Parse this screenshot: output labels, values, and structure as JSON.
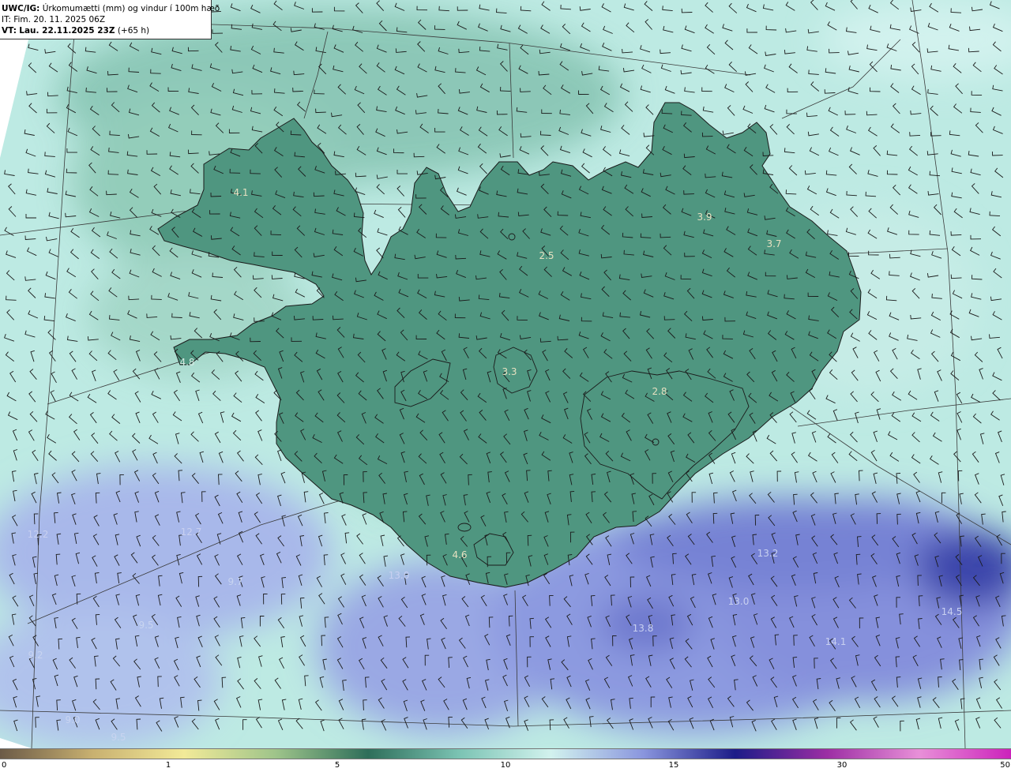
{
  "header": {
    "model": "UWC/IG:",
    "title": "Úrkomumætti (mm) og vindur í 100m hæð",
    "issue_time": "IT: Fim. 20. 11. 2025 06Z",
    "valid_label": "VT:",
    "valid_time": "Lau. 22.11.2025 23Z",
    "lead_time": "(+65 h)"
  },
  "map_labels": [
    {
      "text": "4.1"
    },
    {
      "text": "3.9"
    },
    {
      "text": "3.7"
    },
    {
      "text": "2.5"
    },
    {
      "text": "4.8"
    },
    {
      "text": "3.3"
    },
    {
      "text": "2.8"
    },
    {
      "text": "4.6"
    },
    {
      "text": "12.2"
    },
    {
      "text": "12.7"
    },
    {
      "text": "13.0"
    },
    {
      "text": "13.2"
    },
    {
      "text": "13.0"
    },
    {
      "text": "14.5"
    },
    {
      "text": "13.8"
    },
    {
      "text": "14.1"
    },
    {
      "text": "9.7"
    },
    {
      "text": "9.2"
    },
    {
      "text": "9.5"
    },
    {
      "text": "9.0"
    },
    {
      "text": "9.5"
    }
  ],
  "colorbar": {
    "ticks": [
      {
        "label": "0",
        "value": 0
      },
      {
        "label": "1",
        "value": 1
      },
      {
        "label": "5",
        "value": 5
      },
      {
        "label": "10",
        "value": 10
      },
      {
        "label": "15",
        "value": 15
      },
      {
        "label": "30",
        "value": 30
      },
      {
        "label": "50",
        "value": 50
      }
    ],
    "colors": [
      "#6b5a47",
      "#c8b070",
      "#f2ea98",
      "#9ec48a",
      "#2e6e5a",
      "#7cc4b4",
      "#d2f2ee",
      "#8a96de",
      "#1c1c88",
      "#9c2ea4",
      "#e890d8",
      "#cc22bb"
    ]
  },
  "palette": {
    "sea_light": "#bdeae3",
    "sea_blue": "#a4b2ea",
    "sea_deep": "#6878d0",
    "land_green": "#4f9680",
    "land_dark": "#2c6650",
    "land_yellow": "#b4b878",
    "coast": "#1a1a1a",
    "grid": "#3a3a3a",
    "barb": "#1a1a1a"
  }
}
